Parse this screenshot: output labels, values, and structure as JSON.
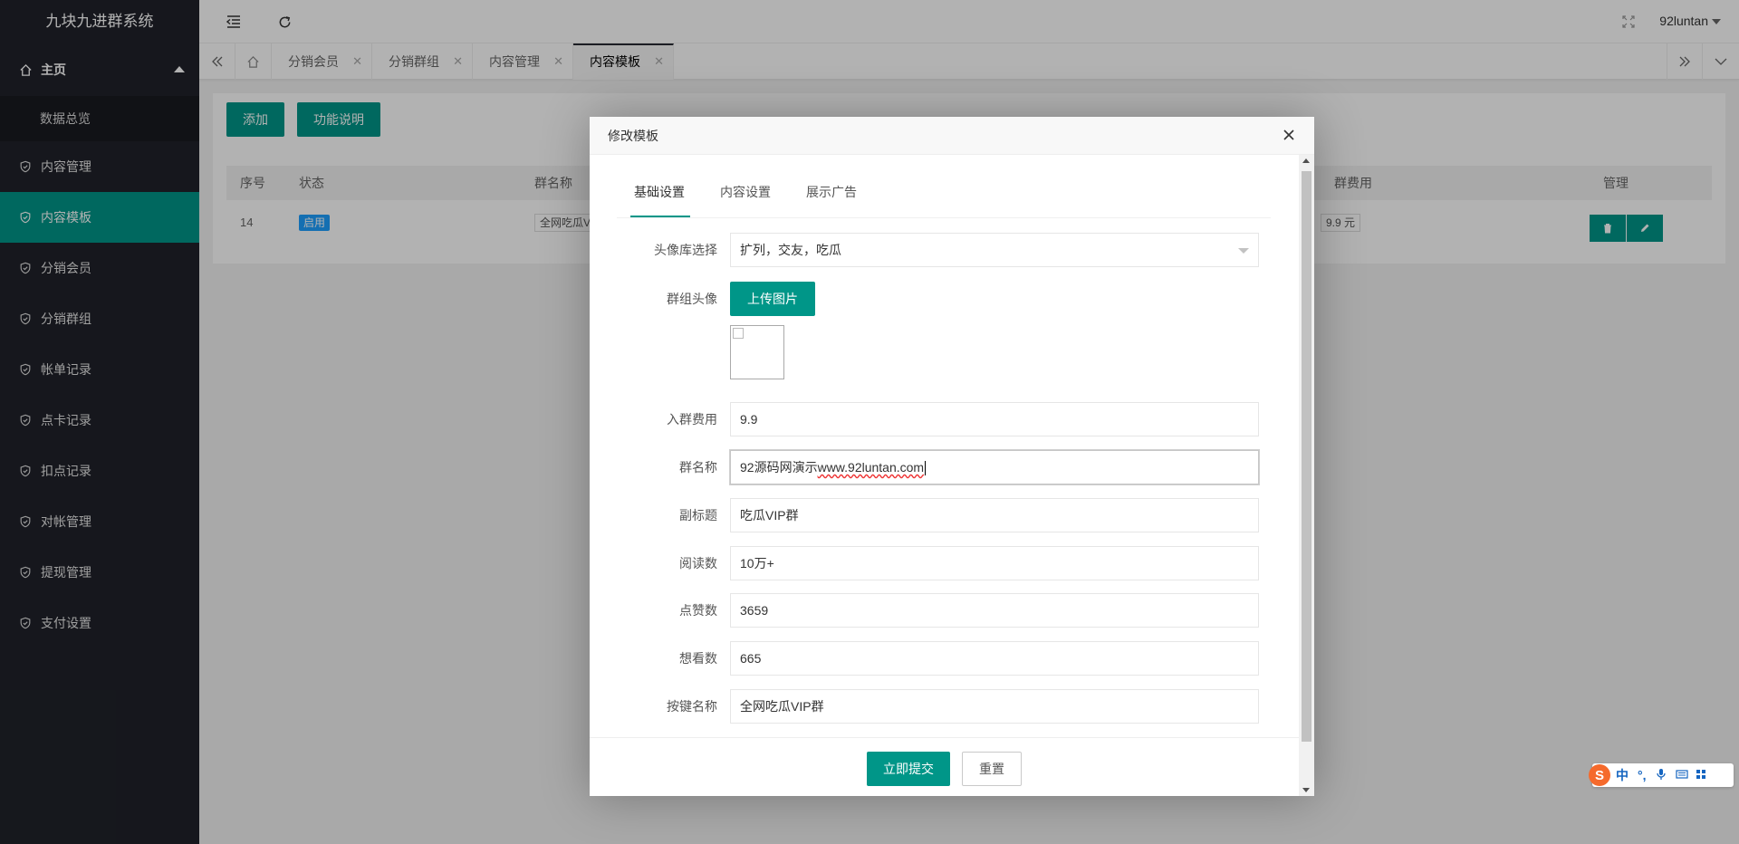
{
  "app": {
    "title": "九块九进群系统"
  },
  "sidebar": {
    "home": "主页",
    "home_sub": "数据总览",
    "items": [
      {
        "label": "内容管理",
        "active": false
      },
      {
        "label": "内容模板",
        "active": true
      },
      {
        "label": "分销会员",
        "active": false
      },
      {
        "label": "分销群组",
        "active": false
      },
      {
        "label": "帐单记录",
        "active": false
      },
      {
        "label": "点卡记录",
        "active": false
      },
      {
        "label": "扣点记录",
        "active": false
      },
      {
        "label": "对帐管理",
        "active": false
      },
      {
        "label": "提现管理",
        "active": false
      },
      {
        "label": "支付设置",
        "active": false
      }
    ]
  },
  "header": {
    "user": "92luntan"
  },
  "tabs": [
    {
      "label": "分销会员",
      "active": false
    },
    {
      "label": "分销群组",
      "active": false
    },
    {
      "label": "内容管理",
      "active": false
    },
    {
      "label": "内容模板",
      "active": true
    }
  ],
  "toolbar": {
    "add": "添加",
    "help": "功能说明"
  },
  "table": {
    "columns": {
      "no": "序号",
      "status": "状态",
      "name": "群名称",
      "fee": "群费用",
      "manage": "管理"
    },
    "rows": [
      {
        "no": "14",
        "status": "启用",
        "name": "全网吃瓜V",
        "fee": "9.9 元"
      }
    ]
  },
  "modal": {
    "title": "修改模板",
    "tabs": [
      "基础设置",
      "内容设置",
      "展示广告"
    ],
    "fields": {
      "avatar_lib": {
        "label": "头像库选择",
        "value": "扩列，交友，吃瓜"
      },
      "group_avatar": {
        "label": "群组头像",
        "button": "上传图片"
      },
      "fee": {
        "label": "入群费用",
        "value": "9.9"
      },
      "name": {
        "label": "群名称",
        "value_prefix": "92源码网演示",
        "value_url": "www.92luntan.com"
      },
      "subtitle": {
        "label": "副标题",
        "value": "吃瓜VIP群"
      },
      "reads": {
        "label": "阅读数",
        "value": "10万+"
      },
      "likes": {
        "label": "点赞数",
        "value": "3659"
      },
      "wants": {
        "label": "想看数",
        "value": "665"
      },
      "button_name": {
        "label": "按键名称",
        "value": "全网吃瓜VIP群"
      }
    },
    "submit": "立即提交",
    "reset": "重置"
  },
  "ime": {
    "lang": "中"
  },
  "colors": {
    "accent": "#009688",
    "sidebar": "#20222a",
    "badge": "#1e9fff"
  }
}
